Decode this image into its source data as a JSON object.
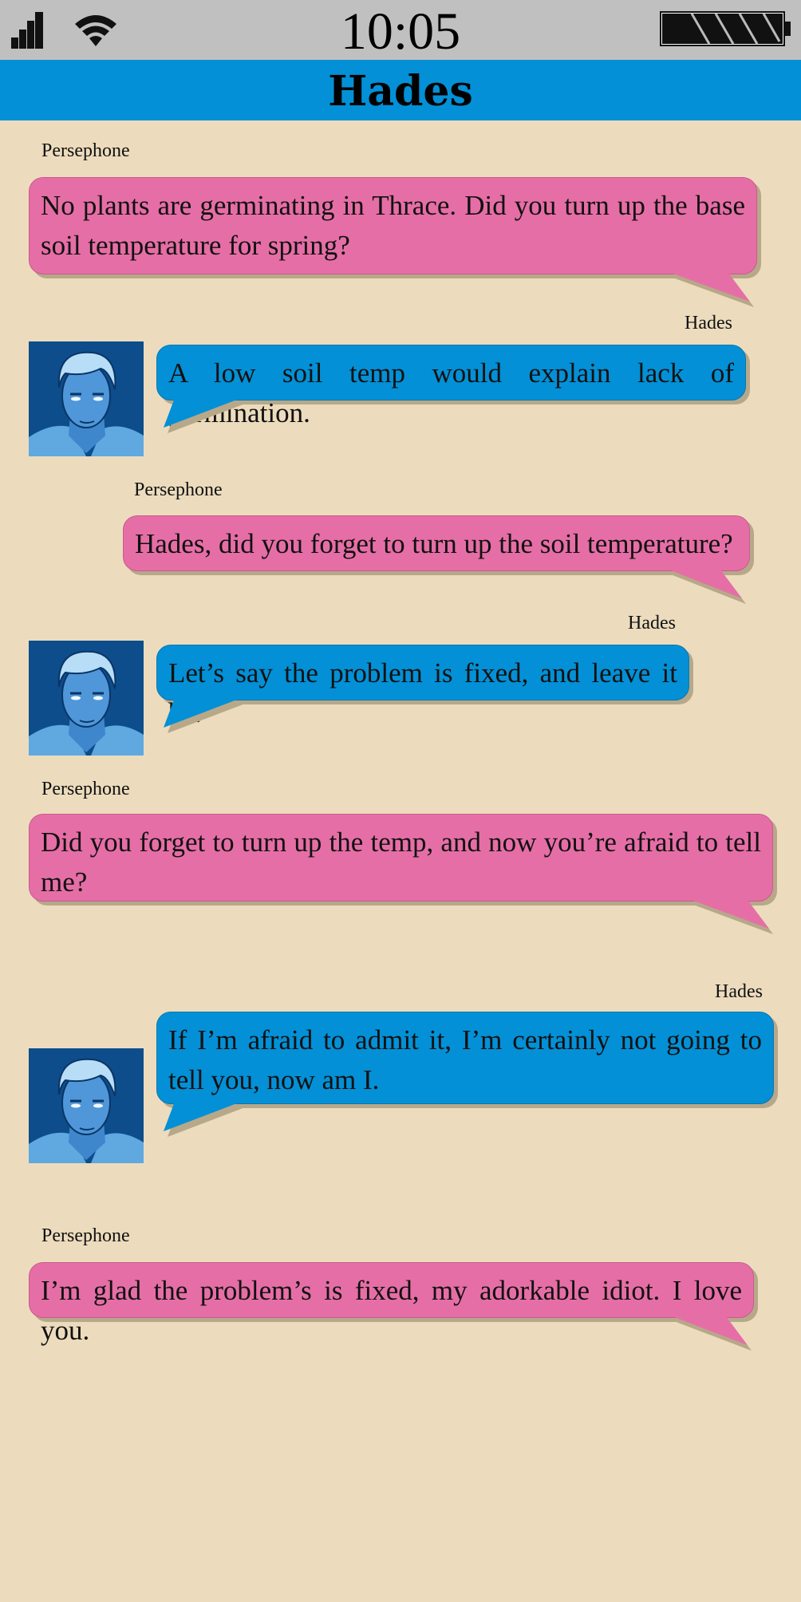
{
  "status_bar": {
    "time": "10:05",
    "signal_icon": "cellular-signal-icon",
    "wifi_icon": "wifi-icon",
    "battery_icon": "battery-icon"
  },
  "header": {
    "title": "Hades"
  },
  "messages": [
    {
      "sender": "Persephone",
      "text": "No plants are germinating in Thrace. Did you turn up the base soil temperature for spring?",
      "color": "#e66ea6"
    },
    {
      "sender": "Hades",
      "text": "A low soil temp would explain lack of germination.",
      "color": "#0390d6"
    },
    {
      "sender": "Persephone",
      "text": "Hades, did you forget to turn up the soil temperature?",
      "color": "#e66ea6"
    },
    {
      "sender": "Hades",
      "text": "Let’s say the problem is fixed, and leave it be.",
      "color": "#0390d6"
    },
    {
      "sender": "Persephone",
      "text": "Did you forget to turn up the temp, and now you’re afraid to tell me?",
      "color": "#e66ea6"
    },
    {
      "sender": "Hades",
      "text": "If I’m afraid to admit it, I’m certainly not going to tell you, now am I.",
      "color": "#0390d6"
    },
    {
      "sender": "Persephone",
      "text": "I’m glad the problem’s is fixed, my adorkable idiot. I love you.",
      "color": "#e66ea6"
    }
  ]
}
